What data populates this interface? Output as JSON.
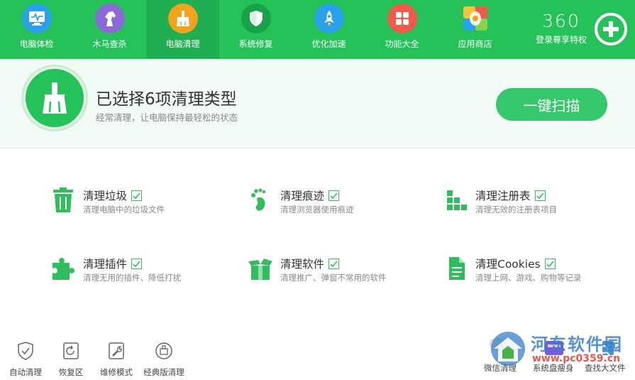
{
  "nav": {
    "items": [
      {
        "label": "电脑体检",
        "icon": "monitor-icon",
        "color": "#2aa1e8"
      },
      {
        "label": "木马查杀",
        "icon": "horse-icon",
        "color": "#8b6ad6"
      },
      {
        "label": "电脑清理",
        "icon": "broom-icon",
        "color": "#f2a21c"
      },
      {
        "label": "系统修复",
        "icon": "shield-icon",
        "color": "#18a24a"
      },
      {
        "label": "优化加速",
        "icon": "rocket-icon",
        "color": "#2aa1e8"
      },
      {
        "label": "功能大全",
        "icon": "grid-icon",
        "color": "#ef5a4a"
      },
      {
        "label": "应用商店",
        "icon": "store-icon",
        "color": "#9ad24a"
      }
    ],
    "active_index": 2
  },
  "brand": {
    "number": "360",
    "label": "登录尊享特权"
  },
  "header": {
    "title": "已选择6项清理类型",
    "subtitle": "经常清理，让电脑保持最轻松的状态",
    "scan_button": "一键扫描"
  },
  "items": [
    {
      "title": "清理垃圾",
      "desc": "清理电脑中的垃圾文件",
      "icon": "trash-icon",
      "checked": true
    },
    {
      "title": "清理痕迹",
      "desc": "清理浏览器使用痕迹",
      "icon": "footprint-icon",
      "checked": true
    },
    {
      "title": "清理注册表",
      "desc": "清理无效的注册表项目",
      "icon": "registry-icon",
      "checked": true
    },
    {
      "title": "清理插件",
      "desc": "清理无用的插件、降低打扰",
      "icon": "puzzle-icon",
      "checked": true
    },
    {
      "title": "清理软件",
      "desc": "清理推广、弹窗不常用的软件",
      "icon": "box-icon",
      "checked": true
    },
    {
      "title": "清理Cookies",
      "desc": "清理上网、游戏、购物等记录",
      "icon": "document-icon",
      "checked": true
    }
  ],
  "bottom": {
    "left": [
      {
        "label": "自动清理",
        "icon": "shield-check-icon"
      },
      {
        "label": "恢复区",
        "icon": "restore-icon"
      },
      {
        "label": "维修模式",
        "icon": "wrench-icon"
      },
      {
        "label": "经典版清理",
        "icon": "classic-icon"
      }
    ],
    "right": [
      {
        "label": "微信清理",
        "icon": "wechat-icon"
      },
      {
        "label": "系统盘瘦身",
        "icon": "disk-icon"
      },
      {
        "label": "查找大文件",
        "icon": "bigfile-icon"
      }
    ]
  },
  "watermark": {
    "text": "河东软件园",
    "url": "www.pc0359.cn"
  },
  "colors": {
    "primary": "#25c25a",
    "active_tab": "#1fae50",
    "band": "#f1faf4",
    "check": "#2fbd5e"
  }
}
